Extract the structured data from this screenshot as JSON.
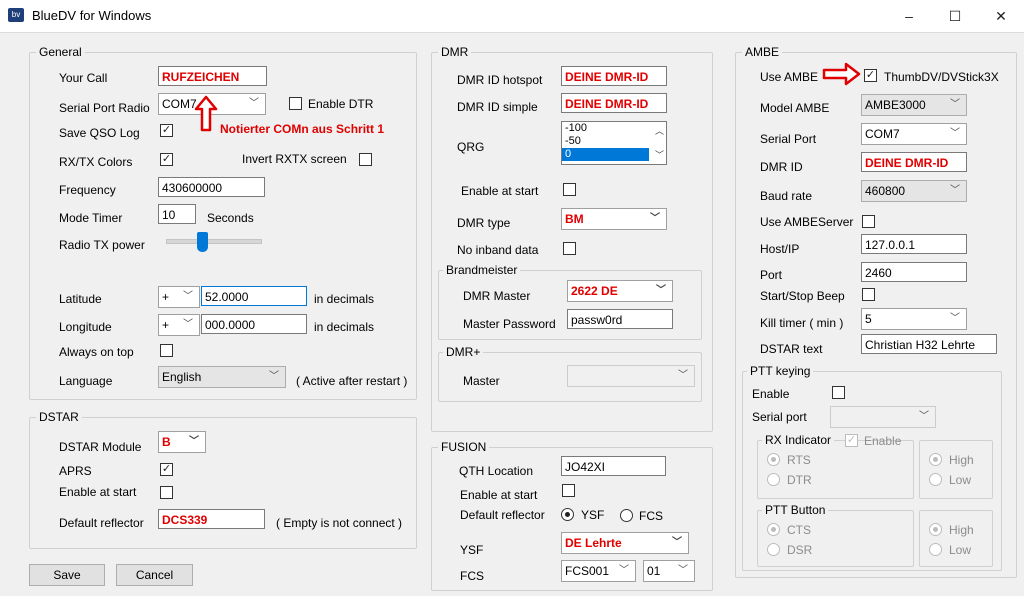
{
  "window": {
    "title": "BlueDV for Windows",
    "icon": "bv"
  },
  "controls": {
    "minimize": "–",
    "maximize": "☐",
    "close": "✕"
  },
  "general": {
    "title": "General",
    "your_call_label": "Your Call",
    "your_call": "RUFZEICHEN",
    "serial_port_label": "Serial Port Radio",
    "serial_port": "COM7",
    "enable_dtr_label": "Enable DTR",
    "save_qso_label": "Save QSO Log",
    "rxtx_colors_label": "RX/TX Colors",
    "invert_label": "Invert RXTX screen",
    "frequency_label": "Frequency",
    "frequency": "430600000",
    "mode_timer_label": "Mode Timer",
    "mode_timer": "10",
    "seconds_label": "Seconds",
    "radio_tx_label": "Radio TX power",
    "latitude_label": "Latitude",
    "latitude_sign": "+",
    "latitude": "52.0000",
    "lat_unit": "in decimals",
    "longitude_label": "Longitude",
    "longitude_sign": "+",
    "longitude": "000.0000",
    "lon_unit": "in decimals",
    "always_top_label": "Always on top",
    "language_label": "Language",
    "language": "English",
    "language_note": "( Active after restart )"
  },
  "annotation": {
    "com_note": "Notierter COMn aus Schritt 1"
  },
  "dstar": {
    "title": "DSTAR",
    "module_label": "DSTAR Module",
    "module": "B",
    "aprs_label": "APRS",
    "enable_start_label": "Enable at start",
    "reflector_label": "Default reflector",
    "reflector": "DCS339",
    "reflector_note": "( Empty is not connect )"
  },
  "buttons": {
    "save": "Save",
    "cancel": "Cancel"
  },
  "dmr": {
    "title": "DMR",
    "id_hotspot_label": "DMR ID hotspot",
    "id_hotspot": "DEINE DMR-ID",
    "id_simple_label": "DMR ID simple",
    "id_simple": "DEINE DMR-ID",
    "qrg_label": "QRG",
    "qrg_items": [
      "-100",
      "-50",
      "0"
    ],
    "enable_start_label": "Enable at start",
    "type_label": "DMR type",
    "type": "BM",
    "no_inband_label": "No inband data",
    "brandmeister_title": "Brandmeister",
    "master_label": "DMR Master",
    "master": "2622 DE",
    "password_label": "Master Password",
    "password": "passw0rd",
    "dmrplus_title": "DMR+",
    "plus_master_label": "Master"
  },
  "fusion": {
    "title": "FUSION",
    "qth_label": "QTH Location",
    "qth": "JO42XI",
    "enable_start_label": "Enable at start",
    "reflector_label": "Default reflector",
    "ysf_opt": "YSF",
    "fcs_opt": "FCS",
    "ysf_label": "YSF",
    "ysf": "DE Lehrte",
    "fcs_label": "FCS",
    "fcs": "FCS001",
    "fcs_room": "01"
  },
  "ambe": {
    "title": "AMBE",
    "use_ambe_label": "Use AMBE",
    "device": "ThumbDV/DVStick3X",
    "model_label": "Model AMBE",
    "model": "AMBE3000",
    "serial_label": "Serial Port",
    "serial": "COM7",
    "dmrid_label": "DMR ID",
    "dmrid": "DEINE DMR-ID",
    "baud_label": "Baud rate",
    "baud": "460800",
    "server_label": "Use AMBEServer",
    "host_label": "Host/IP",
    "host": "127.0.0.1",
    "port_label": "Port",
    "port": "2460",
    "beep_label": "Start/Stop Beep",
    "kill_label": "Kill timer ( min )",
    "kill": "5",
    "dstar_text_label": "DSTAR text",
    "dstar_text": "Christian H32 Lehrte"
  },
  "ptt": {
    "title": "PTT keying",
    "enable_label": "Enable",
    "serial_label": "Serial port",
    "rx_title": "RX Indicator",
    "rx_enable_label": "Enable",
    "rts": "RTS",
    "dtr": "DTR",
    "high": "High",
    "low": "Low",
    "button_title": "PTT Button",
    "cts": "CTS",
    "dsr": "DSR",
    "high2": "High",
    "low2": "Low"
  },
  "colors": {
    "annotation": "#e00000",
    "selection": "#0078d7",
    "slider": "#0078d7"
  }
}
